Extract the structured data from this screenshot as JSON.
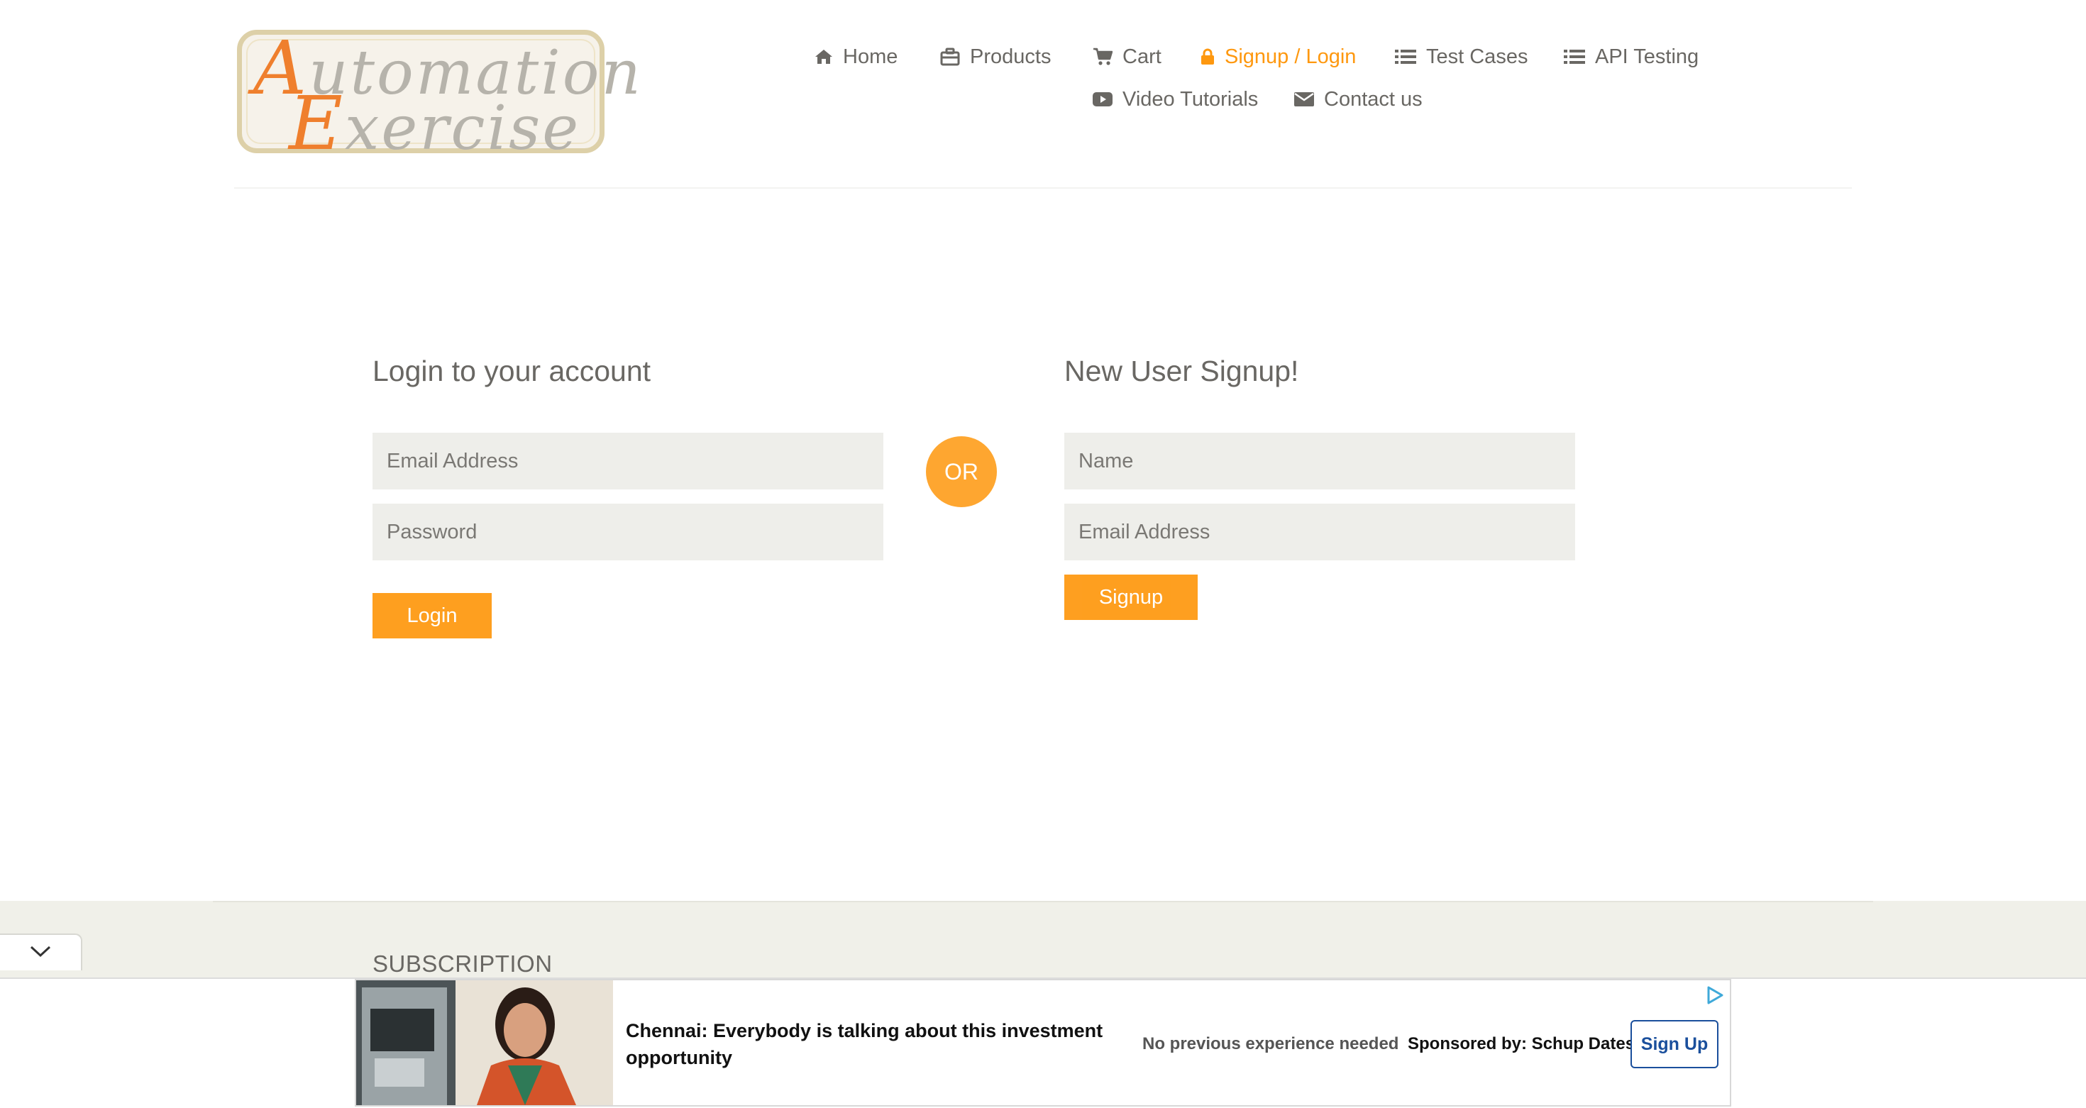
{
  "logo": {
    "line1_cap": "A",
    "line1_rest": "utomation",
    "line2_cap": "E",
    "line2_rest": "xercise"
  },
  "nav": {
    "items": [
      {
        "label": "Home",
        "icon": "home-icon"
      },
      {
        "label": "Products",
        "icon": "briefcase-icon"
      },
      {
        "label": "Cart",
        "icon": "cart-icon"
      },
      {
        "label": "Signup / Login",
        "icon": "lock-icon",
        "active": true
      },
      {
        "label": "Test Cases",
        "icon": "list-icon"
      },
      {
        "label": "API Testing",
        "icon": "list-icon"
      },
      {
        "label": "Video Tutorials",
        "icon": "youtube-play-icon"
      },
      {
        "label": "Contact us",
        "icon": "envelope-icon"
      }
    ]
  },
  "login": {
    "title": "Login to your account",
    "email_placeholder": "Email Address",
    "password_placeholder": "Password",
    "button": "Login"
  },
  "or_label": "OR",
  "signup": {
    "title": "New User Signup!",
    "name_placeholder": "Name",
    "email_placeholder": "Email Address",
    "button": "Signup"
  },
  "footer": {
    "subscription_title": "SUBSCRIPTION"
  },
  "ad": {
    "headline": "Chennai: Everybody is talking about this investment opportunity",
    "note": "No previous experience needed",
    "sponsor": "Sponsored by: Schup Dates",
    "cta": "Sign Up"
  },
  "colors": {
    "accent": "#fe980f",
    "text": "#696763",
    "field_bg": "#eeeeea",
    "footer_bg": "#f0f0e9",
    "ad_cta": "#1a4f9c"
  }
}
